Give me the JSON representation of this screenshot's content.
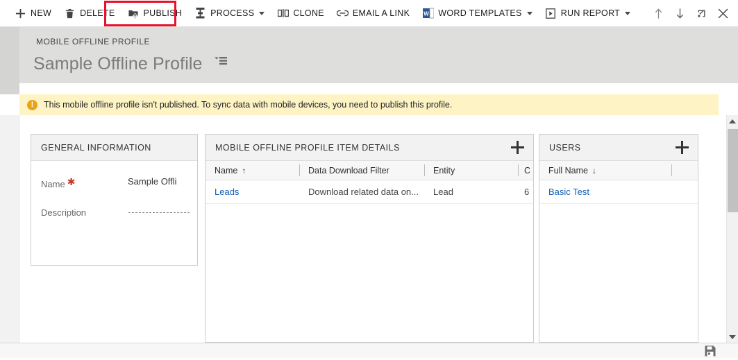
{
  "command_bar": {
    "buttons": [
      {
        "label": "NEW",
        "icon": "plus-icon",
        "has_caret": false
      },
      {
        "label": "DELETE",
        "icon": "trash-icon",
        "has_caret": false
      },
      {
        "label": "PUBLISH",
        "icon": "publish-upload-icon",
        "has_caret": false,
        "highlighted": true
      },
      {
        "label": "PROCESS",
        "icon": "process-icon",
        "has_caret": true
      },
      {
        "label": "CLONE",
        "icon": "clone-icon",
        "has_caret": false
      },
      {
        "label": "EMAIL A LINK",
        "icon": "link-icon",
        "has_caret": false
      },
      {
        "label": "WORD TEMPLATES",
        "icon": "word-document-icon",
        "has_caret": true
      },
      {
        "label": "RUN REPORT",
        "icon": "run-report-icon",
        "has_caret": true
      }
    ],
    "right_icons": [
      {
        "name": "previous-record-up-arrow-icon"
      },
      {
        "name": "next-record-down-arrow-icon"
      },
      {
        "name": "pop-out-icon"
      },
      {
        "name": "close-icon"
      }
    ],
    "highlight_color": "#e8112d"
  },
  "header": {
    "breadcrumb": "MOBILE OFFLINE PROFILE",
    "title": "Sample Offline Profile",
    "form_selector_icon": "form-selector-icon"
  },
  "notification": {
    "icon": "warning-icon",
    "icon_color": "#e8a317",
    "background": "#fdf3c4",
    "message": "This mobile offline profile isn't published. To sync data with mobile devices, you need to publish this profile."
  },
  "general_information": {
    "title": "GENERAL INFORMATION",
    "fields": [
      {
        "label": "Name",
        "required": true,
        "value": "Sample Offli"
      },
      {
        "label": "Description",
        "required": false,
        "value": ""
      }
    ]
  },
  "profile_items": {
    "title": "MOBILE OFFLINE PROFILE ITEM DETAILS",
    "add_icon": "plus-icon",
    "columns": [
      {
        "label": "Name",
        "sort": "↑"
      },
      {
        "label": "Data Download Filter",
        "sort": ""
      },
      {
        "label": "Entity",
        "sort": ""
      },
      {
        "label": "C",
        "sort": ""
      }
    ],
    "rows": [
      {
        "name": "Leads",
        "filter": "Download related data on...",
        "entity": "Lead",
        "extra": "6"
      }
    ]
  },
  "users": {
    "title": "USERS",
    "add_icon": "plus-icon",
    "columns": [
      {
        "label": "Full Name",
        "sort": "↓"
      }
    ],
    "rows": [
      {
        "full_name": "Basic Test"
      }
    ]
  },
  "scrollbar": {
    "up_icon": "scroll-up-arrow-icon",
    "down_icon": "scroll-down-arrow-icon"
  },
  "footer": {
    "save_icon": "save-floppy-icon"
  }
}
